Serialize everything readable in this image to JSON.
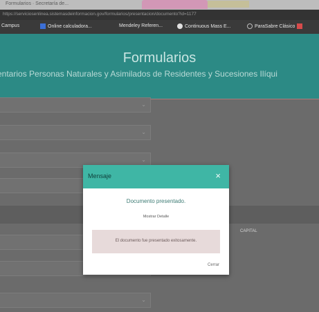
{
  "browser": {
    "tab_title": "Formularios · Secretaría de...",
    "url": "https://serviciosenlinea.sistemasdeinformacion.gov/formularios/presentacion/documento?id=1177",
    "bookmarks": [
      {
        "label": "Campus",
        "icon": "bookmark-icon"
      },
      {
        "label": "Online calculadora...",
        "icon": "calculator-icon"
      },
      {
        "label": "Mendeley Referen...",
        "icon": "bookmark-icon"
      },
      {
        "label": "Continuous Mass E...",
        "icon": "globe-icon"
      },
      {
        "label": "ParaSabre Clásico",
        "icon": "globe-icon"
      }
    ]
  },
  "header": {
    "title": "Formularios",
    "subtitle": "entarios Personas Naturales y Asimilados de Residentes y Sucesiones Ilíqui"
  },
  "form": {
    "field_chevron": "⌄",
    "side_label": "CAPITAL"
  },
  "modal": {
    "title": "Mensaje",
    "close_glyph": "×",
    "message": "Documento presentado.",
    "detail_link": "Mostrar Detalle",
    "alert": "El documento fue presentado exitosamente.",
    "close_label": "Cerrar"
  },
  "colors": {
    "header_teal": "#2c8a85",
    "modal_header": "#3fb6a5",
    "alert_bg": "#e7dada"
  }
}
